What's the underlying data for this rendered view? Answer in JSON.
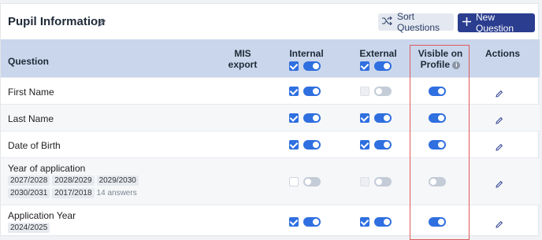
{
  "header": {
    "title": "Pupil Information",
    "sort_label": "Sort Questions",
    "new_label": "New Question"
  },
  "columns": {
    "question": "Question",
    "mis_export": "MIS export",
    "internal": "Internal",
    "external": "External",
    "visible_line1": "Visible on",
    "visible_line2": "Profile",
    "actions": "Actions"
  },
  "column_states": {
    "internal_checkbox": true,
    "internal_toggle": true,
    "external_checkbox": true,
    "external_toggle": true
  },
  "rows": [
    {
      "question": "First Name",
      "internal_checkbox": true,
      "internal_toggle": true,
      "external_checkbox": "disabled",
      "external_toggle": false,
      "visible": true
    },
    {
      "question": "Last Name",
      "internal_checkbox": true,
      "internal_toggle": true,
      "external_checkbox": true,
      "external_toggle": true,
      "visible": true
    },
    {
      "question": "Date of Birth",
      "internal_checkbox": true,
      "internal_toggle": true,
      "external_checkbox": true,
      "external_toggle": true,
      "visible": true
    },
    {
      "question": "Year of application",
      "tags": [
        "2027/2028",
        "2028/2029",
        "2029/2030",
        "2030/2031",
        "2017/2018"
      ],
      "answers": "14 answers",
      "internal_checkbox": false,
      "internal_toggle": false,
      "external_checkbox": "disabled",
      "external_toggle": false,
      "visible": false
    },
    {
      "question": "Application Year",
      "tags": [
        "2024/2025"
      ],
      "internal_checkbox": true,
      "internal_toggle": true,
      "external_checkbox": true,
      "external_toggle": true,
      "visible": true
    }
  ],
  "icons": {
    "edit_title": "pencil-icon",
    "sort": "shuffle-icon",
    "new": "plus-icon",
    "info": "info-icon",
    "row_edit": "pencil-icon"
  },
  "colors": {
    "primary": "#2f6fe0",
    "header_bg": "#c9d6ec",
    "new_button": "#2a3d8f",
    "highlight": "#e05a5a"
  }
}
